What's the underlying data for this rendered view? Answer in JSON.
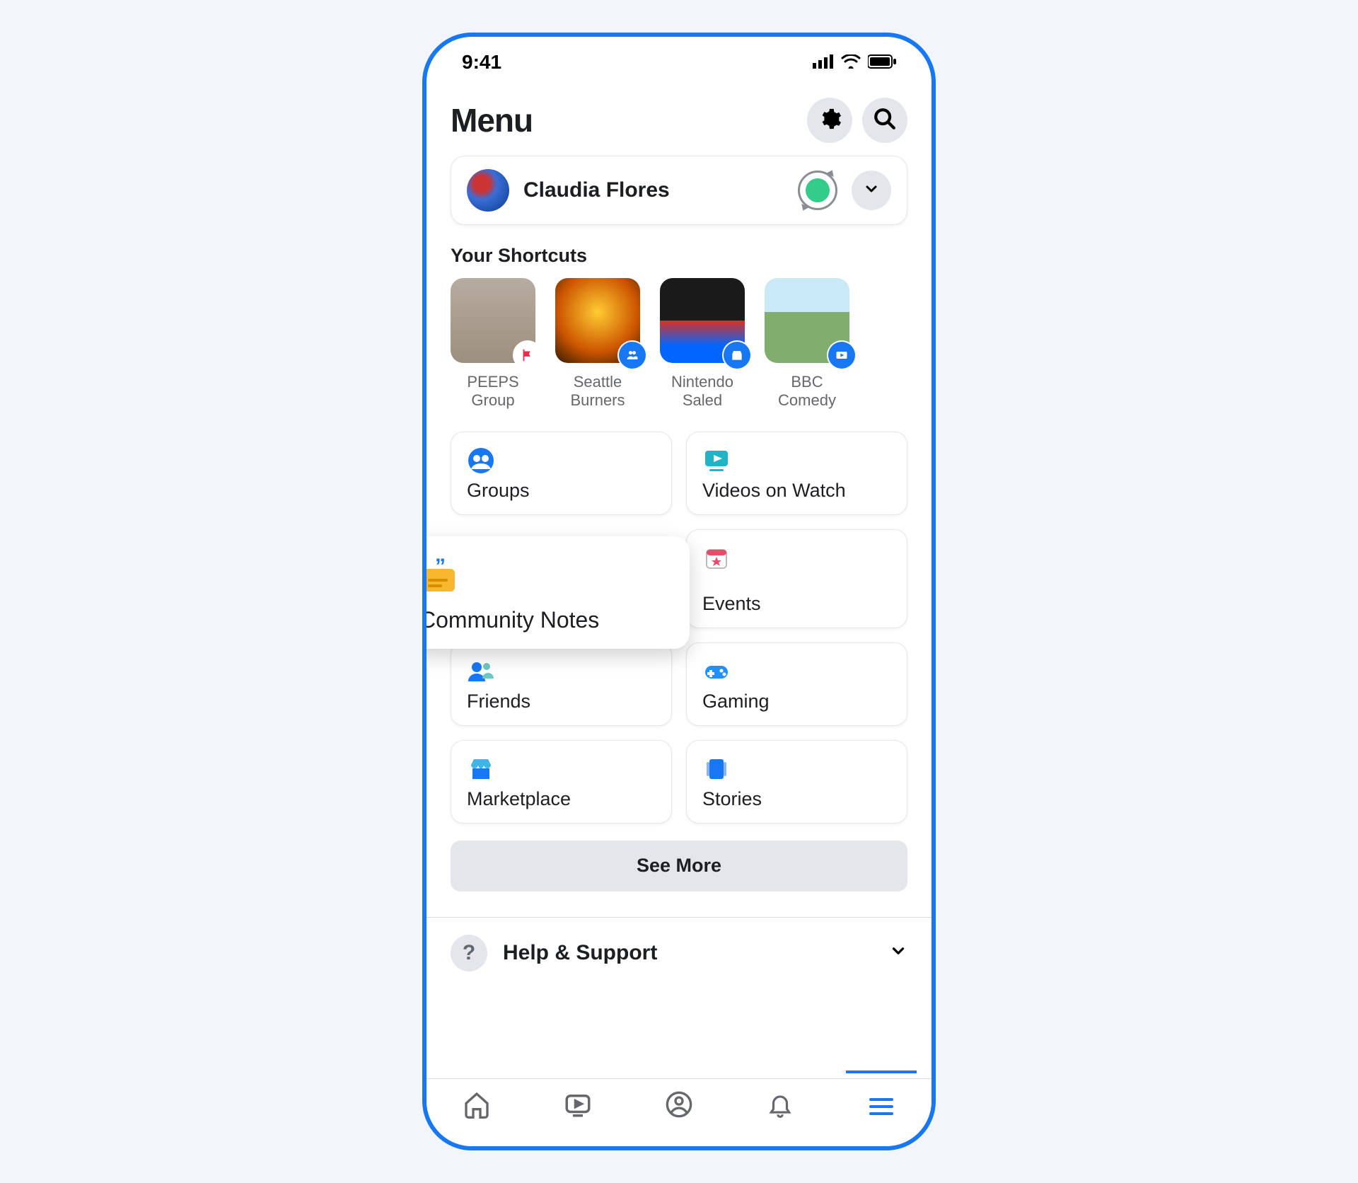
{
  "status": {
    "time": "9:41"
  },
  "header": {
    "title": "Menu"
  },
  "profile": {
    "name": "Claudia Flores"
  },
  "shortcuts": {
    "title": "Your Shortcuts",
    "items": [
      {
        "label": "PEEPS Group"
      },
      {
        "label": "Seattle Burners"
      },
      {
        "label": "Nintendo Saled"
      },
      {
        "label": "BBC Comedy"
      }
    ]
  },
  "tiles": {
    "groups": "Groups",
    "videos": "Videos on Watch",
    "community_notes": "Community Notes",
    "events": "Events",
    "friends": "Friends",
    "gaming": "Gaming",
    "marketplace": "Marketplace",
    "stories": "Stories"
  },
  "see_more": "See More",
  "help": {
    "label": "Help & Support",
    "icon_text": "?"
  }
}
